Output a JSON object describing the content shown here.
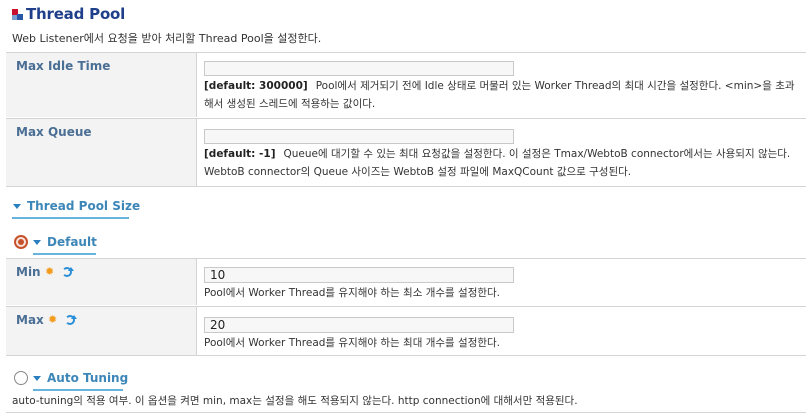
{
  "header": {
    "title": "Thread Pool",
    "subtitle": "Web Listener에서 요청을 받아 처리할 Thread Pool을 설정한다."
  },
  "fields": {
    "max_idle_time": {
      "label": "Max Idle Time",
      "value": "",
      "default_label": "[default: 300000]",
      "description": "Pool에서 제거되기 전에 Idle 상태로 머물러 있는 Worker Thread의 최대 시간을 설정한다. <min>을 초과해서 생성된 스레드에 적용하는 값이다."
    },
    "max_queue": {
      "label": "Max Queue",
      "value": "",
      "default_label": "[default: -1]",
      "description": "Queue에 대기할 수 있는 최대 요청값을 설정한다. 이 설정은 Tmax/WebtoB connector에서는 사용되지 않는다. WebtoB connector의 Queue 사이즈는 WebtoB 설정 파일에 MaxQCount 값으로 구성된다."
    }
  },
  "thread_pool_size": {
    "section_label": "Thread Pool Size",
    "default_option": {
      "label": "Default",
      "selected": true,
      "min": {
        "label": "Min",
        "value": "10",
        "description": "Pool에서 Worker Thread를 유지해야 하는 최소 개수를 설정한다."
      },
      "max": {
        "label": "Max",
        "value": "20",
        "description": "Pool에서 Worker Thread를 유지해야 하는 최대 개수를 설정한다."
      }
    },
    "auto_tuning_option": {
      "label": "Auto Tuning",
      "selected": false,
      "description": "auto-tuning의 적용 여부. 이 옵션을 켜면 min, max는 설정을 해도 적용되지 않는다. http connection에 대해서만 적용된다."
    }
  },
  "icons": {
    "title_icon": "thread-pool-icon",
    "required_icon": "asterisk-icon",
    "reload_icon": "refresh-icon",
    "expand_icon": "triangle-down-icon"
  },
  "colors": {
    "title": "#1f3f8a",
    "label": "#4a6e94",
    "section": "#3d86b8",
    "radio_selected": "#c8502a",
    "required": "#f29b1d",
    "refresh": "#2a8fd8"
  }
}
